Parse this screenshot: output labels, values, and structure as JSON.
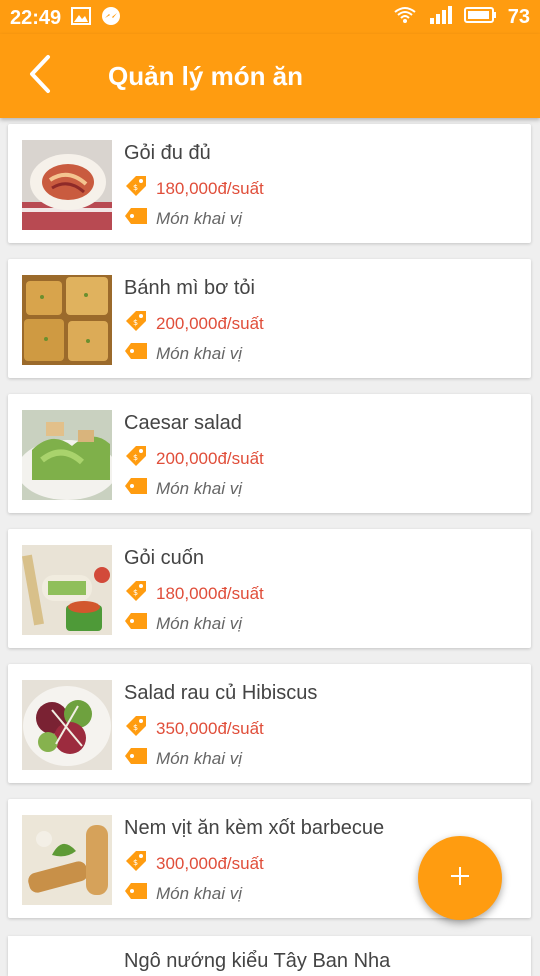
{
  "status": {
    "time": "22:49",
    "battery": "73"
  },
  "appbar": {
    "title": "Quản lý món ăn"
  },
  "dishes": [
    {
      "name": "Gỏi đu đủ",
      "price": "180,000đ/suất",
      "category": "Món khai vị"
    },
    {
      "name": "Bánh mì bơ tỏi",
      "price": "200,000đ/suất",
      "category": "Món khai vị"
    },
    {
      "name": "Caesar salad",
      "price": "200,000đ/suất",
      "category": "Món khai vị"
    },
    {
      "name": "Gỏi cuốn",
      "price": "180,000đ/suất",
      "category": "Món khai vị"
    },
    {
      "name": "Salad rau củ Hibiscus",
      "price": "350,000đ/suất",
      "category": "Món khai vị"
    },
    {
      "name": "Nem vịt ăn kèm xốt barbecue",
      "price": "300,000đ/suất",
      "category": "Món khai vị"
    }
  ],
  "partial_dish": {
    "name": "Ngô nướng kiểu Tây Ban Nha"
  },
  "colors": {
    "accent": "#ff9c10",
    "price": "#e04e3a"
  },
  "icons": {
    "back": "chevron-left-icon",
    "price": "price-tag-icon",
    "category": "category-tag-icon",
    "fab": "plus-icon"
  }
}
